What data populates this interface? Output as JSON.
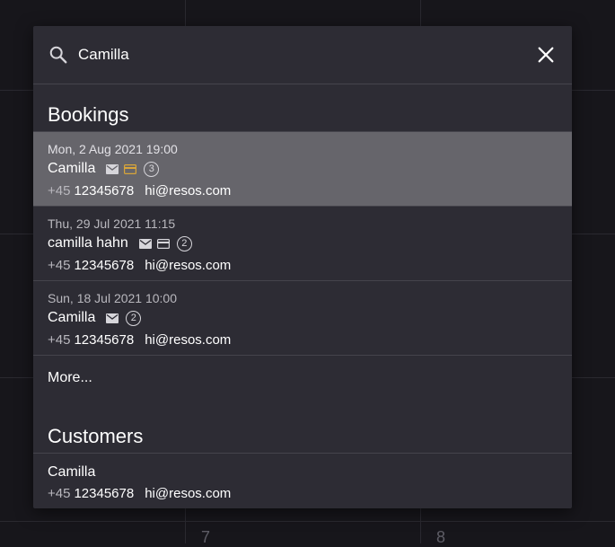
{
  "search": {
    "value": "Camilla",
    "placeholder": ""
  },
  "background": {
    "day_numbers": [
      "7",
      "8"
    ]
  },
  "bookings": {
    "title": "Bookings",
    "items": [
      {
        "date": "Mon, 2 Aug 2021 19:00",
        "name": "Camilla",
        "guests": "3",
        "country_code": "+45",
        "phone": "12345678",
        "email": "hi@resos.com",
        "has_mail": true,
        "has_card": true,
        "card_color": "#d8a53a",
        "selected": true
      },
      {
        "date": "Thu, 29 Jul 2021 11:15",
        "name": "camilla hahn",
        "guests": "2",
        "country_code": "+45",
        "phone": "12345678",
        "email": "hi@resos.com",
        "has_mail": true,
        "has_card": true,
        "card_color": "#d6d5da",
        "selected": false
      },
      {
        "date": "Sun, 18 Jul 2021 10:00",
        "name": "Camilla",
        "guests": "2",
        "country_code": "+45",
        "phone": "12345678",
        "email": "hi@resos.com",
        "has_mail": true,
        "has_card": false,
        "card_color": "",
        "selected": false
      }
    ],
    "more_label": "More..."
  },
  "customers": {
    "title": "Customers",
    "items": [
      {
        "name": "Camilla",
        "country_code": "+45",
        "phone": "12345678",
        "email": "hi@resos.com"
      }
    ]
  },
  "colors": {
    "panel_bg": "#2d2c34",
    "selected_row_bg": "#66656b",
    "page_bg": "#17161b",
    "card_accent": "#d8a53a"
  },
  "icons": {
    "search": "search-icon",
    "close": "close-icon",
    "mail": "mail-icon",
    "card": "credit-card-icon"
  }
}
